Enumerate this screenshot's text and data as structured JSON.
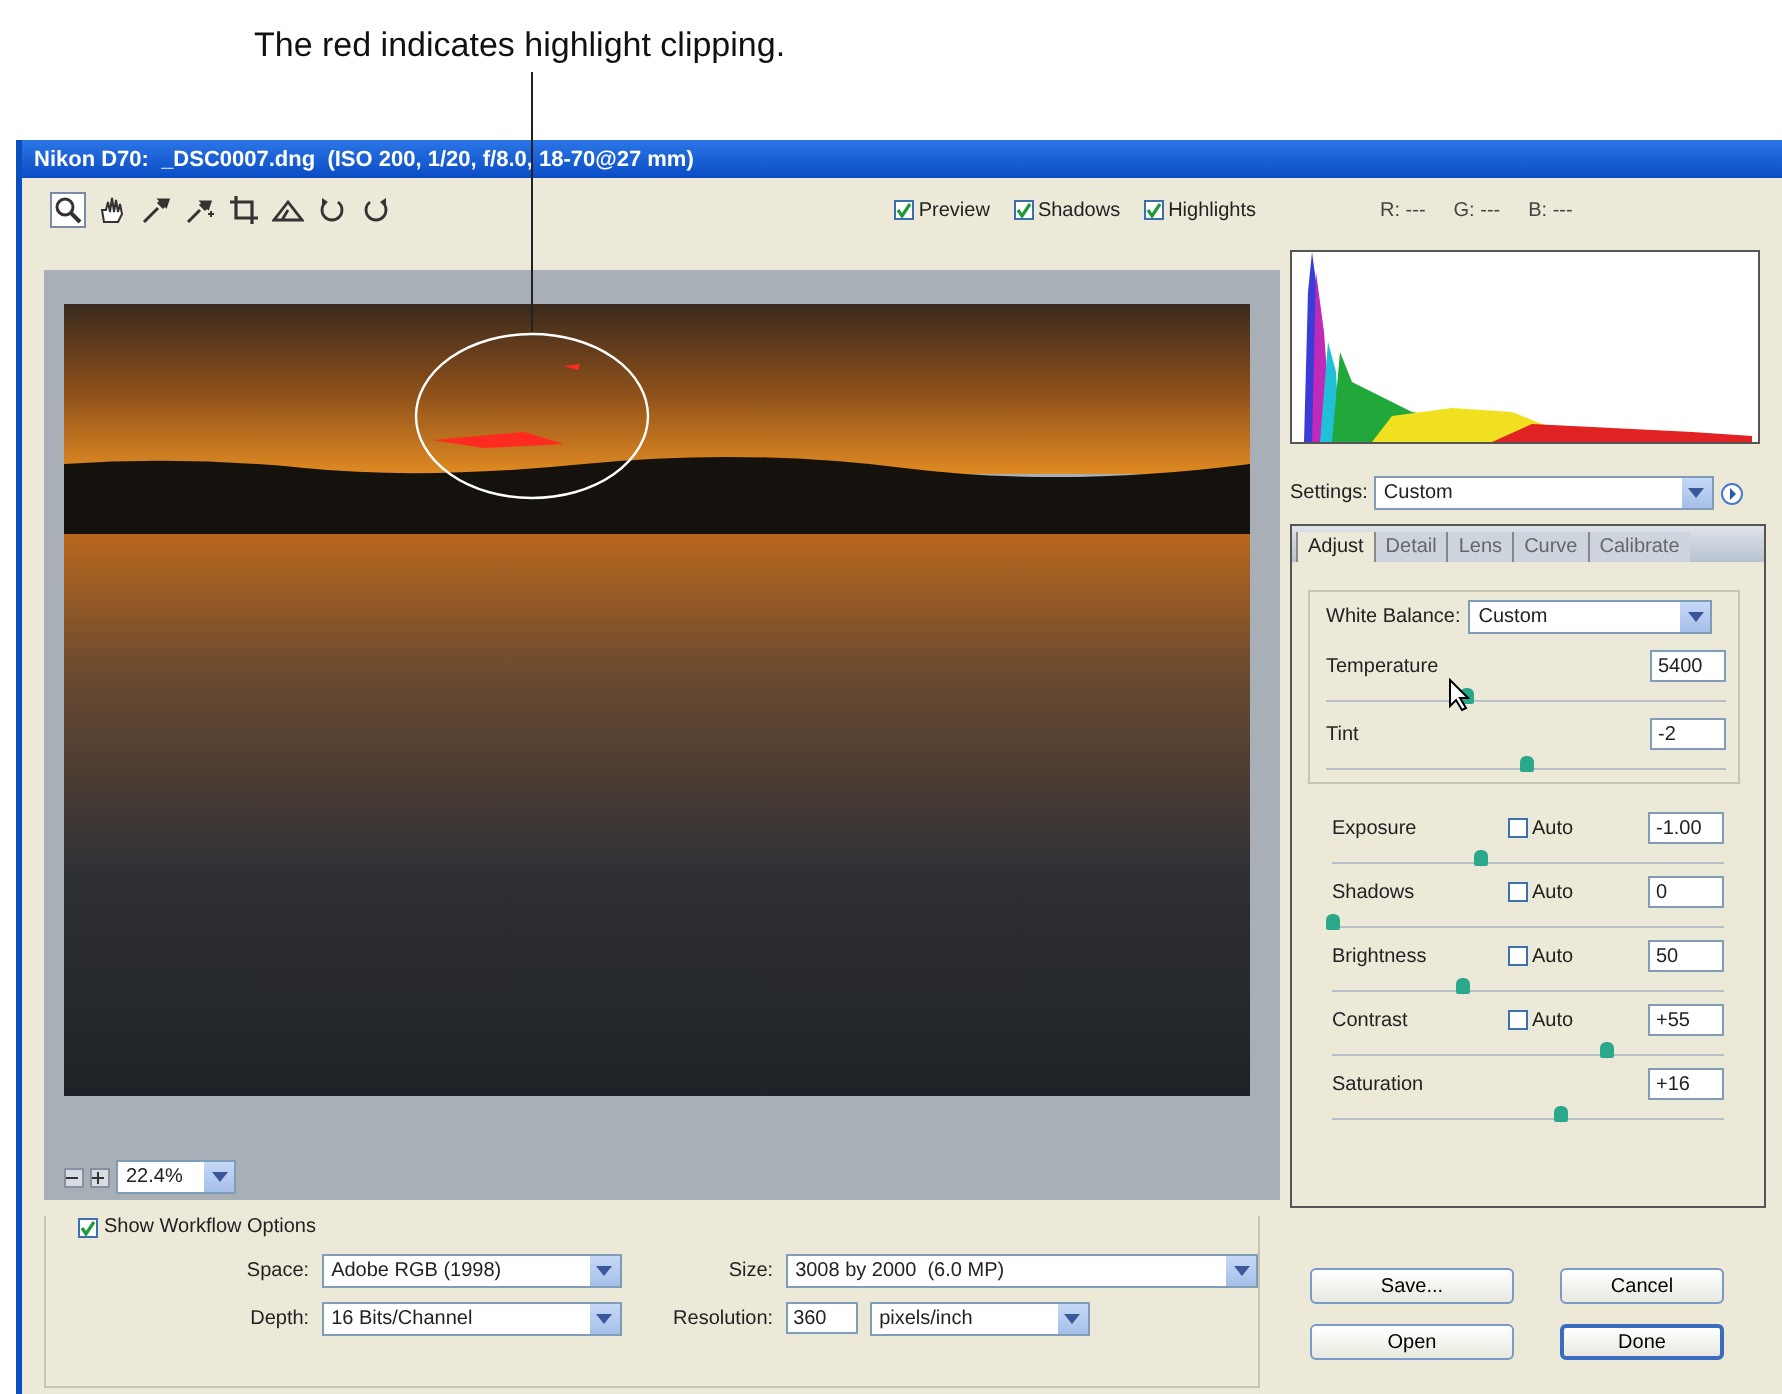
{
  "annotation": {
    "caption": "The red indicates highlight clipping."
  },
  "window": {
    "title": "Nikon D70:  _DSC0007.dng  (ISO 200, 1/20, f/8.0, 18-70@27 mm)"
  },
  "tools": [
    {
      "kind": "zoom",
      "selected": true
    },
    {
      "kind": "hand",
      "selected": false
    },
    {
      "kind": "eyedropper",
      "selected": false
    },
    {
      "kind": "sampler",
      "selected": false
    },
    {
      "kind": "crop",
      "selected": false
    },
    {
      "kind": "straighten",
      "selected": false
    },
    {
      "kind": "rotate_left",
      "selected": false
    },
    {
      "kind": "rotate_right",
      "selected": false
    }
  ],
  "view_options": [
    {
      "label": "Preview",
      "checked": true
    },
    {
      "label": "Shadows",
      "checked": true
    },
    {
      "label": "Highlights",
      "checked": true
    }
  ],
  "readout": [
    "R: ---",
    "G: ---",
    "B: ---"
  ],
  "zoom": {
    "value": "22.4%"
  },
  "settings": {
    "label": "Settings:",
    "value": "Custom"
  },
  "tabs": [
    {
      "label": "Adjust",
      "selected": true
    },
    {
      "label": "Detail",
      "selected": false
    },
    {
      "label": "Lens",
      "selected": false
    },
    {
      "label": "Curve",
      "selected": false
    },
    {
      "label": "Calibrate",
      "selected": false
    }
  ],
  "white_balance": {
    "label": "White Balance:",
    "value": "Custom",
    "sliders": [
      {
        "name": "Temperature",
        "value": "5400",
        "level": 0.35
      },
      {
        "name": "Tint",
        "value": "-2",
        "level": 0.5
      }
    ]
  },
  "adjustments": [
    {
      "name": "Exposure",
      "kind": "auto",
      "auto_label": "Auto",
      "auto": false,
      "value": "-1.00",
      "level": 0.38
    },
    {
      "name": "Shadows",
      "kind": "auto",
      "auto_label": "Auto",
      "auto": false,
      "value": "0",
      "level": 0.0
    },
    {
      "name": "Brightness",
      "kind": "auto",
      "auto_label": "Auto",
      "auto": false,
      "value": "50",
      "level": 0.33
    },
    {
      "name": "Contrast",
      "kind": "auto",
      "auto_label": "Auto",
      "auto": false,
      "value": "+55",
      "level": 0.7
    },
    {
      "name": "Saturation",
      "kind": "plain",
      "value": "+16",
      "level": 0.58
    }
  ],
  "workflow": {
    "label": "Show Workflow Options",
    "checked": true,
    "fields": [
      {
        "label": "Space:",
        "kind": "select",
        "value": "Adobe RGB (1998)"
      },
      {
        "label": "Size:",
        "kind": "select",
        "value": "3008 by 2000  (6.0 MP)"
      },
      {
        "label": "Depth:",
        "kind": "select",
        "value": "16 Bits/Channel"
      },
      {
        "label": "Resolution:",
        "kind": "input_unit",
        "value": "360",
        "unit": "pixels/inch"
      }
    ]
  },
  "buttons": [
    {
      "label": "Save...",
      "default": false
    },
    {
      "label": "Cancel",
      "default": false
    },
    {
      "label": "Open",
      "default": false
    },
    {
      "label": "Done",
      "default": true
    }
  ]
}
